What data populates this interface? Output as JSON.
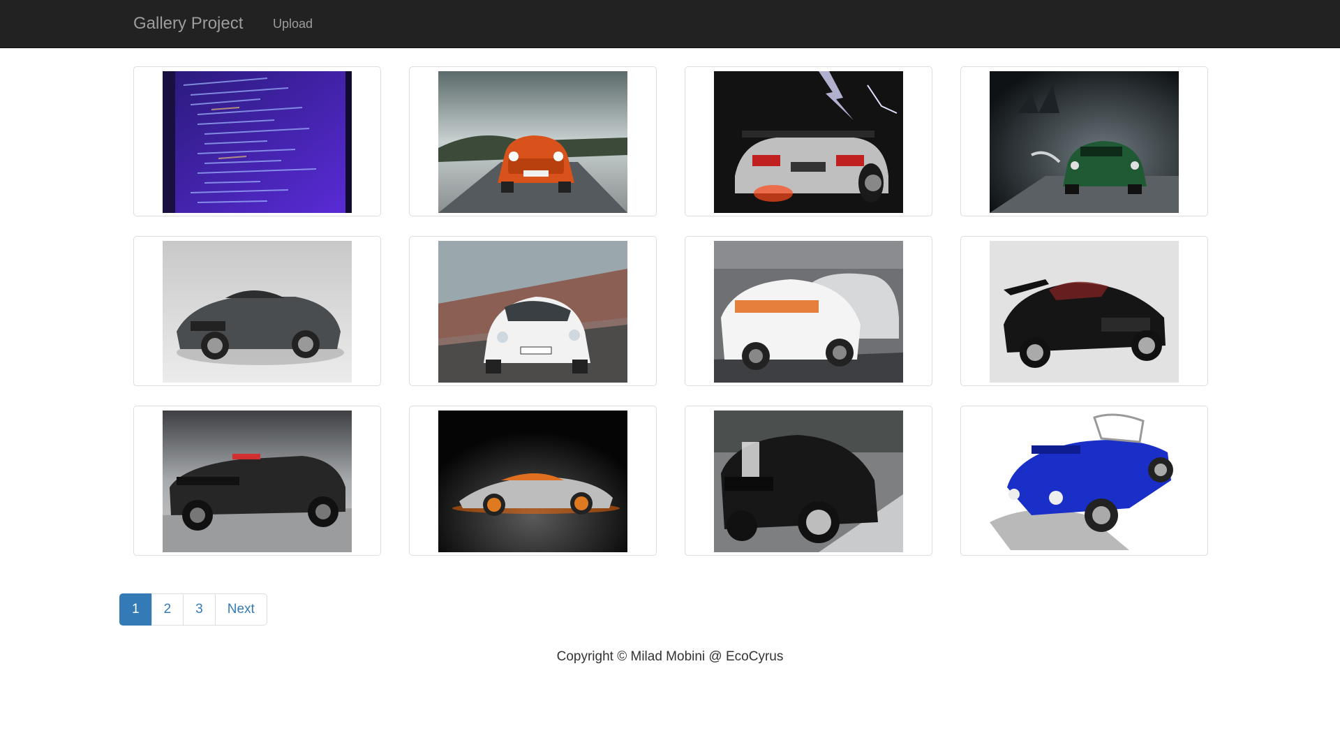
{
  "navbar": {
    "brand": "Gallery Project",
    "links": [
      "Upload"
    ]
  },
  "gallery": {
    "items": [
      {
        "subject": "code-screen"
      },
      {
        "subject": "orange-car"
      },
      {
        "subject": "silver-supercar-lightning"
      },
      {
        "subject": "green-muscle-car"
      },
      {
        "subject": "grey-supercar"
      },
      {
        "subject": "white-hatchback"
      },
      {
        "subject": "safety-car"
      },
      {
        "subject": "black-sports-car"
      },
      {
        "subject": "black-muscle-car-red-stripe"
      },
      {
        "subject": "silver-concept-car"
      },
      {
        "subject": "black-muscle-car-street"
      },
      {
        "subject": "blue-roadster"
      }
    ]
  },
  "pagination": {
    "pages": [
      "1",
      "2",
      "3"
    ],
    "active": "1",
    "next_label": "Next"
  },
  "footer": {
    "text": "Copyright © Milad Mobini @ EcoCyrus"
  },
  "colors": {
    "navbar_bg": "#222222",
    "navbar_text": "#9d9d9d",
    "link": "#337ab7",
    "active_page_bg": "#337ab7"
  }
}
